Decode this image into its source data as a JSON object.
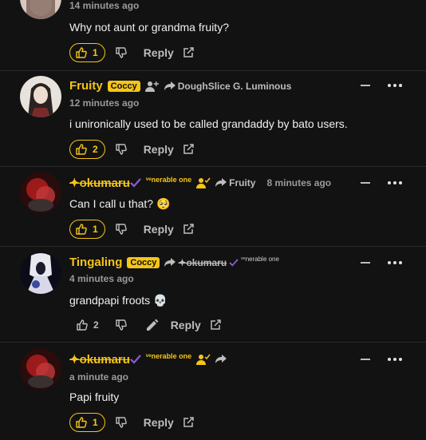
{
  "comments": [
    {
      "time": "14 minutes ago",
      "text": "Why not aunt or grandma fruity?",
      "likes": "1",
      "reply_label": "Reply"
    },
    {
      "username": "Fruity",
      "badge": "Coccy",
      "reply_to": "DoughSlice G. Luminous",
      "time": "12 minutes ago",
      "text": "i unironically used to be called grandaddy by bato users.",
      "likes": "2",
      "reply_label": "Reply"
    },
    {
      "username": "✦okumaru",
      "title": "ᵛᵉnerable one",
      "reply_to": "Fruity",
      "time": "8 minutes ago",
      "text": "Can I call u that? 🥺",
      "likes": "1",
      "reply_label": "Reply"
    },
    {
      "username": "Tingaling",
      "badge": "Coccy",
      "reply_to": "✦okumaru",
      "reply_to_title": "ᵛᵉnerable one",
      "time": "4 minutes ago",
      "text": "grandpapi froots 💀",
      "likes": "2",
      "reply_label": "Reply"
    },
    {
      "username": "✦okumaru",
      "title": "ᵛᵉnerable one",
      "time": "a minute ago",
      "text": "Papi fruity",
      "likes": "1",
      "reply_label": "Reply"
    }
  ],
  "icons": [
    "thumbs-up-icon",
    "thumbs-down-icon",
    "share-icon",
    "reply-arrow-icon",
    "add-friend-icon",
    "check-badge-icon",
    "pencil-icon",
    "more-icon",
    "collapse-icon"
  ],
  "colors": {
    "accent": "#f5c518",
    "background": "#121212",
    "verified": "#8a5cd6"
  }
}
